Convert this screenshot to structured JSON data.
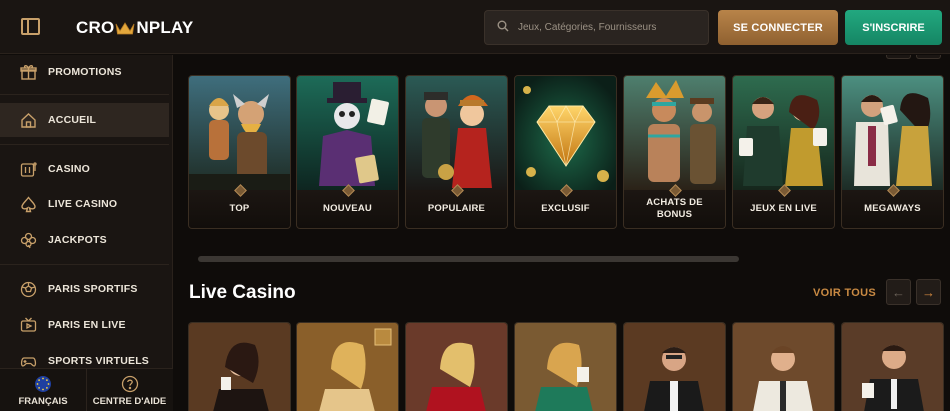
{
  "header": {
    "logo_text_left": "CRO",
    "logo_text_right": "NPLAY",
    "search_placeholder": "Jeux, Catégories, Fournisseurs",
    "login_label": "SE CONNECTER",
    "signup_label": "S'INSCRIRE"
  },
  "sidebar": {
    "items": [
      {
        "label": "PROMOTIONS",
        "icon": "gift-icon"
      },
      {
        "label": "ACCUEIL",
        "icon": "home-icon",
        "active": true
      },
      {
        "label": "CASINO",
        "icon": "slot-machine-icon"
      },
      {
        "label": "LIVE CASINO",
        "icon": "spade-icon"
      },
      {
        "label": "JACKPOTS",
        "icon": "clover-icon"
      },
      {
        "label": "PARIS SPORTIFS",
        "icon": "football-icon"
      },
      {
        "label": "PARIS EN LIVE",
        "icon": "tv-icon"
      },
      {
        "label": "SPORTS VIRTUELS",
        "icon": "gamepad-icon"
      }
    ],
    "footer": {
      "language_label": "FRANÇAIS",
      "help_label": "CENTRE D'AIDE"
    }
  },
  "categories": [
    {
      "label_line1": "TOP",
      "label_line2": ""
    },
    {
      "label_line1": "NOUVEAU",
      "label_line2": ""
    },
    {
      "label_line1": "POPULAIRE",
      "label_line2": ""
    },
    {
      "label_line1": "EXCLUSIF",
      "label_line2": ""
    },
    {
      "label_line1": "ACHATS DE",
      "label_line2": "BONUS"
    },
    {
      "label_line1": "JEUX EN LIVE",
      "label_line2": ""
    },
    {
      "label_line1": "MEGAWAYS",
      "label_line2": ""
    }
  ],
  "live_casino": {
    "title": "Live Casino",
    "see_all_label": "VOIR TOUS",
    "prev_glyph": "←",
    "next_glyph": "→"
  },
  "colors": {
    "accent_gold": "#c98a43",
    "signup_green": "#1f9e76",
    "background": "#0f0c0a"
  }
}
